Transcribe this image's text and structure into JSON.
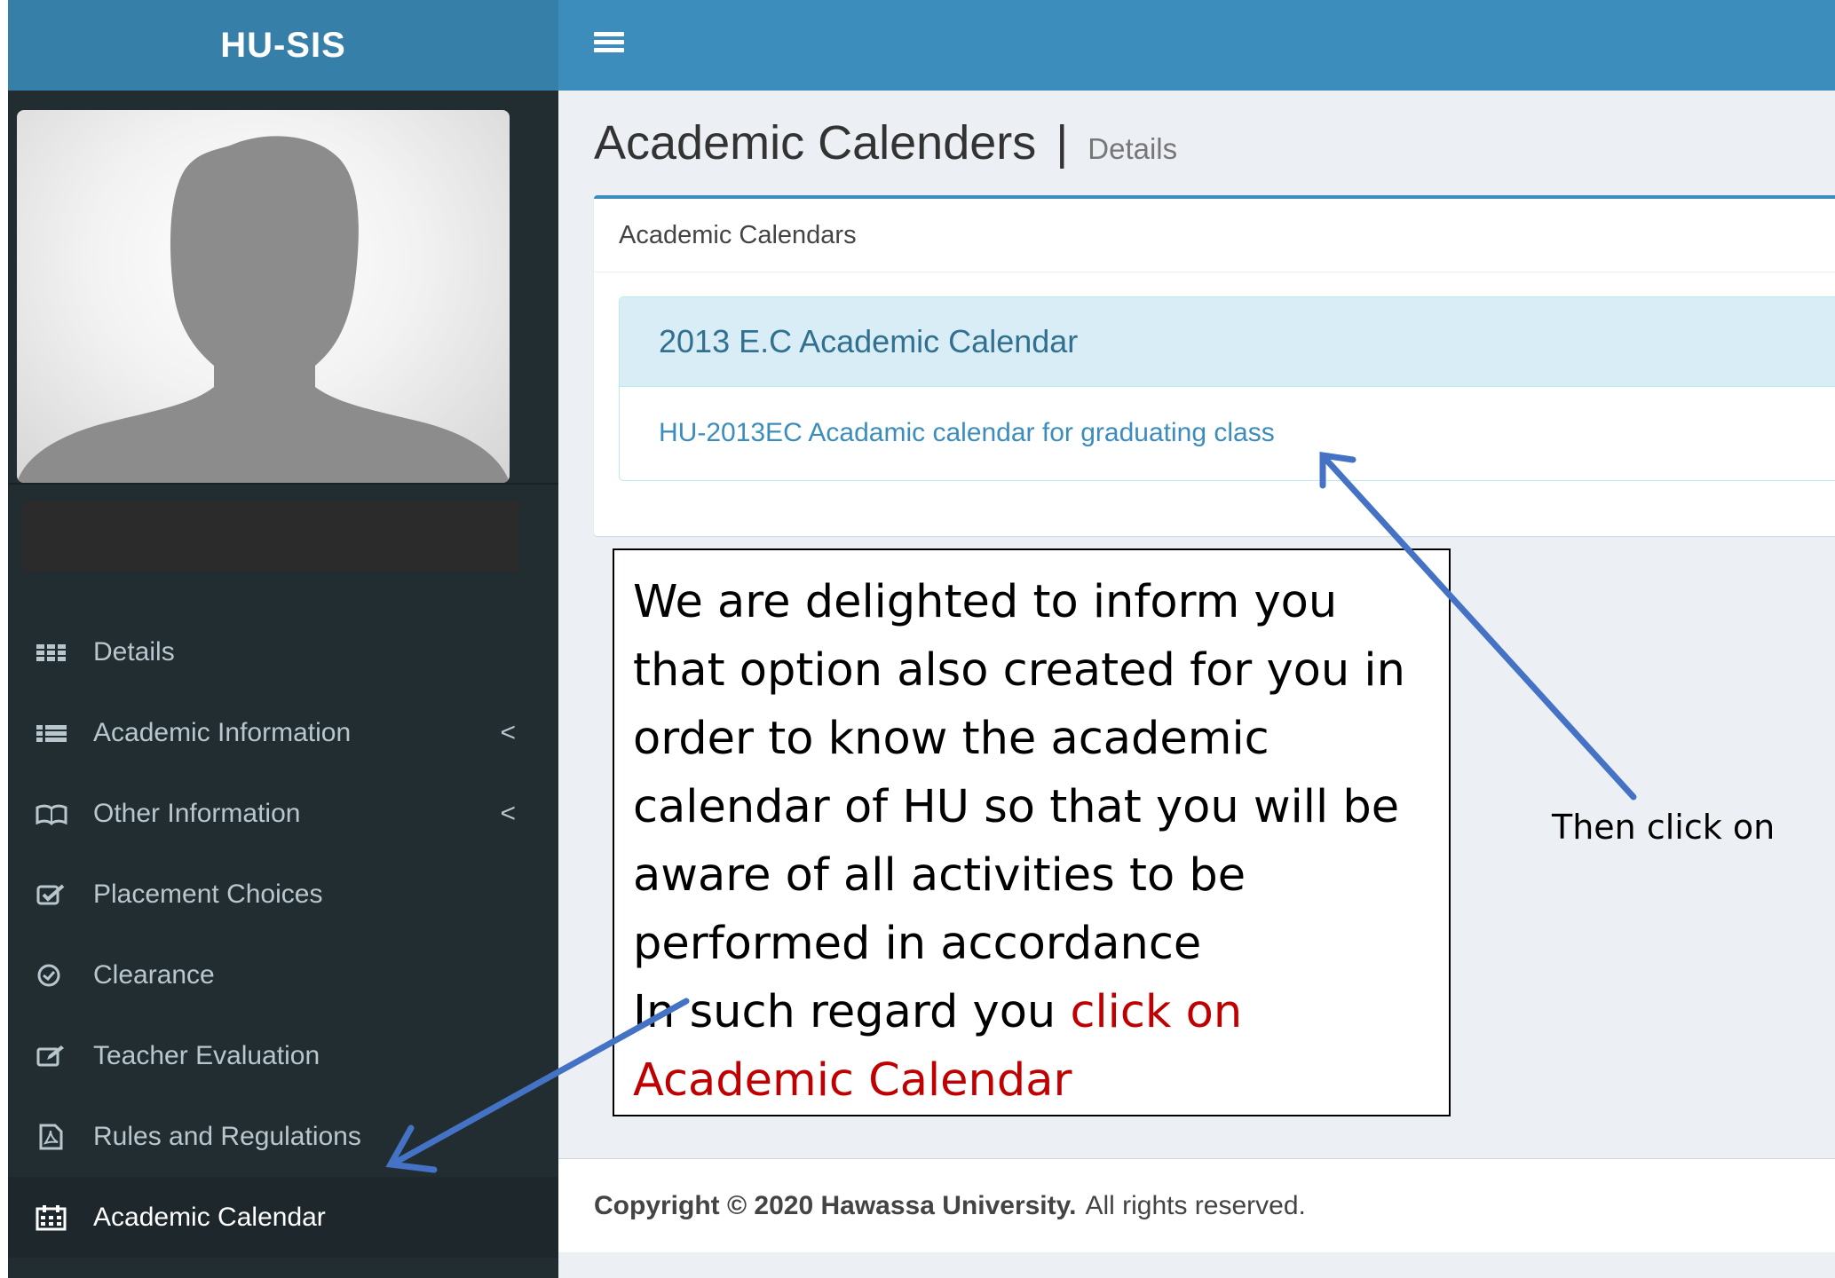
{
  "header": {
    "brand": "HU-SIS",
    "menu_toggle_icon": "hamburger-menu-icon"
  },
  "sidebar": {
    "avatar_icon": "default-user-silhouette",
    "items": [
      {
        "label": "Details",
        "icon": "grid-icon",
        "has_submenu": false,
        "active": false
      },
      {
        "label": "Academic Information",
        "icon": "list-icon",
        "has_submenu": true,
        "active": false
      },
      {
        "label": "Other Information",
        "icon": "book-icon",
        "has_submenu": true,
        "active": false
      },
      {
        "label": "Placement Choices",
        "icon": "check-square-icon",
        "has_submenu": false,
        "active": false
      },
      {
        "label": "Clearance",
        "icon": "check-circle-icon",
        "has_submenu": false,
        "active": false
      },
      {
        "label": "Teacher Evaluation",
        "icon": "edit-icon",
        "has_submenu": false,
        "active": false
      },
      {
        "label": "Rules and Regulations",
        "icon": "pdf-file-icon",
        "has_submenu": false,
        "active": false
      },
      {
        "label": "Academic Calendar",
        "icon": "calendar-icon",
        "has_submenu": false,
        "active": true
      }
    ],
    "submenu_chevron": "<"
  },
  "main": {
    "title": "Academic Calenders",
    "separator": "|",
    "subtitle": "Details",
    "box_title": "Academic Calendars",
    "panel_heading": "2013 E.C Academic Calendar",
    "panel_link": "HU-2013EC Acadamic calendar for graduating class"
  },
  "footer": {
    "copyright_bold": "Copyright © 2020 Hawassa University.",
    "copyright_rest": "All rights reserved."
  },
  "annotation": {
    "lines": [
      "We are delighted to inform you",
      "that option also created for you in",
      "order to know the academic",
      "calendar of HU so that you will be",
      "aware of all activities to be",
      "performed  in accordance"
    ],
    "last_prefix": "In such regard you ",
    "last_highlight_1": "click on",
    "last_highlight_2": "Academic Calendar",
    "then_label": "Then click on"
  },
  "colors": {
    "header_bar": "#3c8dbc",
    "brand_bar": "#367fa9",
    "sidebar": "#222d32",
    "content_bg": "#ecf0f5",
    "panel_heading_bg": "#d9edf7",
    "annotation_red": "#c00000",
    "arrow_blue": "#4472c4"
  }
}
